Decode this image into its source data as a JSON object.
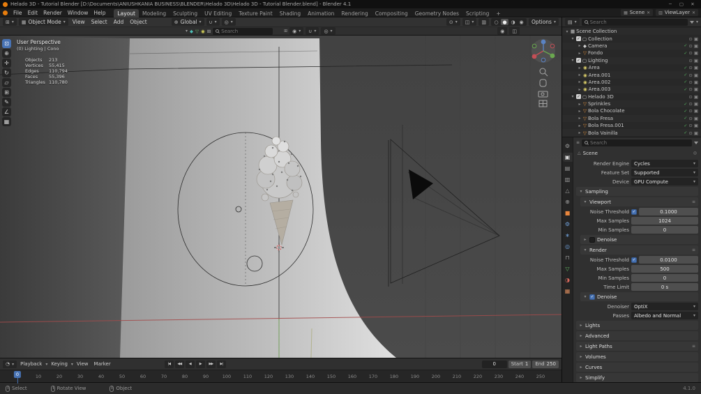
{
  "colors": {
    "accent": "#4772b3",
    "selection_orange": "#e87d0d"
  },
  "icons": {
    "caret_down": "▾",
    "caret_right": "▸",
    "check": "✓",
    "close": "✕",
    "minimize": "─",
    "maximize": "▢",
    "eye": "⊙",
    "screen": "▣",
    "pin": "◎",
    "handle": "≡",
    "editor_viewport": "⊞",
    "editor_outliner": "▤",
    "editor_properties": "≡",
    "editor_timeline": "◔",
    "globe": "⊕",
    "magnet": "∪",
    "proportional": "◎",
    "pivot": "◉",
    "overlays": "◫",
    "xray": "▥",
    "scene_chip": "▦",
    "viewlayer_chip": "▥",
    "scene_collection": "▦",
    "collection": "▢",
    "camera_obj": "◆",
    "mesh": "▽",
    "light": "◉",
    "mode_cube": "▦",
    "scene_props": "△",
    "clipboard": "⊞"
  },
  "titlebar": {
    "title": "Helado 3D - Tutorial Blender [D:\\Documents\\ANIUSHKANIA BUSINESS\\BLENDER\\Helado 3D\\Helado 3D - Tutorial Blender.blend] - Blender 4.1"
  },
  "topbar": {
    "menus": {
      "file": "File",
      "edit": "Edit",
      "render": "Render",
      "window": "Window",
      "help": "Help"
    },
    "workspaces": [
      "Layout",
      "Modeling",
      "Sculpting",
      "UV Editing",
      "Texture Paint",
      "Shading",
      "Animation",
      "Rendering",
      "Compositing",
      "Geometry Nodes",
      "Scripting"
    ],
    "add_workspace": "+",
    "scene_label": "Scene",
    "viewlayer_label": "ViewLayer"
  },
  "vp_header": {
    "mode": "Object Mode",
    "view": "View",
    "select": "Select",
    "add": "Add",
    "object": "Object",
    "orientation": "Global",
    "options": "Options"
  },
  "vp_strip": {
    "search_placeholder": "Search",
    "filter_icons": [
      "◆",
      "▽",
      "◉",
      "⊞"
    ]
  },
  "viewport": {
    "view_label": "User Perspective",
    "context_label": "(0) Lighting | Cono",
    "stats": [
      {
        "label": "Objects",
        "value": "213"
      },
      {
        "label": "Vertices",
        "value": "55,415"
      },
      {
        "label": "Edges",
        "value": "110,794"
      },
      {
        "label": "Faces",
        "value": "55,396"
      },
      {
        "label": "Triangles",
        "value": "110,780"
      }
    ],
    "toolbar": [
      {
        "name": "select-box",
        "glyph": "⊡"
      },
      {
        "name": "cursor",
        "glyph": "⊕"
      },
      {
        "name": "move",
        "glyph": "✛"
      },
      {
        "name": "rotate",
        "glyph": "↻"
      },
      {
        "name": "scale",
        "glyph": "▱"
      },
      {
        "name": "transform",
        "glyph": "⊞"
      },
      {
        "name": "annotate",
        "glyph": "✎"
      },
      {
        "name": "measure",
        "glyph": "∠"
      },
      {
        "name": "add-cube",
        "glyph": "▦"
      }
    ],
    "shading_modes": [
      "○",
      "●",
      "◑",
      "◉"
    ]
  },
  "outliner": {
    "search_placeholder": "Search",
    "items": [
      {
        "label": "Scene Collection"
      },
      {
        "label": "Collection"
      },
      {
        "label": "Camera"
      },
      {
        "label": "Fondo"
      },
      {
        "label": "Lighting"
      },
      {
        "label": "Area"
      },
      {
        "label": "Area.001"
      },
      {
        "label": "Area.002"
      },
      {
        "label": "Area.003"
      },
      {
        "label": "Helado 3D"
      },
      {
        "label": "Sprinkles"
      },
      {
        "label": "Bola Chocolate"
      },
      {
        "label": "Bola Fresa"
      },
      {
        "label": "Bola Fresa.001"
      },
      {
        "label": "Bola Vainilla"
      }
    ]
  },
  "properties": {
    "search_placeholder": "Search",
    "breadcrumb": "Scene",
    "render_engine": {
      "label": "Render Engine",
      "value": "Cycles"
    },
    "feature_set": {
      "label": "Feature Set",
      "value": "Supported"
    },
    "device": {
      "label": "Device",
      "value": "GPU Compute"
    },
    "sampling_title": "Sampling",
    "viewport_panel": {
      "title": "Viewport",
      "noise_threshold": {
        "label": "Noise Threshold",
        "value": "0.1000"
      },
      "max_samples": {
        "label": "Max Samples",
        "value": "1024"
      },
      "min_samples": {
        "label": "Min Samples",
        "value": "0"
      },
      "denoise_label": "Denoise"
    },
    "render_panel": {
      "title": "Render",
      "noise_threshold": {
        "label": "Noise Threshold",
        "value": "0.0100"
      },
      "max_samples": {
        "label": "Max Samples",
        "value": "500"
      },
      "min_samples": {
        "label": "Min Samples",
        "value": "0"
      },
      "time_limit": {
        "label": "Time Limit",
        "value": "0 s"
      },
      "denoise_label": "Denoise",
      "denoiser": {
        "label": "Denoiser",
        "value": "OptiX"
      },
      "passes": {
        "label": "Passes",
        "value": "Albedo and Normal"
      }
    },
    "collapsed_sections": [
      "Lights",
      "Advanced",
      "Light Paths",
      "Volumes",
      "Curves",
      "Simplify"
    ],
    "tabs": [
      {
        "name": "tool",
        "glyph": "⚙"
      },
      {
        "name": "render",
        "glyph": "▣"
      },
      {
        "name": "output",
        "glyph": "▤"
      },
      {
        "name": "view-layer",
        "glyph": "▥"
      },
      {
        "name": "scene",
        "glyph": "△"
      },
      {
        "name": "world",
        "glyph": "⊕"
      },
      {
        "name": "object",
        "glyph": "■"
      },
      {
        "name": "modifiers",
        "glyph": "⚙"
      },
      {
        "name": "particles",
        "glyph": "∗"
      },
      {
        "name": "physics",
        "glyph": "◎"
      },
      {
        "name": "constraints",
        "glyph": "⊓"
      },
      {
        "name": "data",
        "glyph": "▽"
      },
      {
        "name": "material",
        "glyph": "◑"
      },
      {
        "name": "texture",
        "glyph": "▦"
      }
    ]
  },
  "timeline": {
    "playback": "Playback",
    "keying": "Keying",
    "view": "View",
    "marker": "Marker",
    "transport": [
      "|◀",
      "◀◀",
      "◀",
      "▶",
      "▶▶",
      "▶|"
    ],
    "current_frame": "0",
    "playhead": "0",
    "start_label": "Start",
    "start_value": "1",
    "end_label": "End",
    "end_value": "250",
    "ticks": [
      "0",
      "10",
      "20",
      "30",
      "40",
      "50",
      "60",
      "70",
      "80",
      "90",
      "100",
      "110",
      "120",
      "130",
      "140",
      "150",
      "160",
      "170",
      "180",
      "190",
      "200",
      "210",
      "220",
      "230",
      "240",
      "250"
    ]
  },
  "statusbar": {
    "items": [
      "Select",
      "Rotate View",
      "Object"
    ],
    "version": "4.1.0"
  }
}
